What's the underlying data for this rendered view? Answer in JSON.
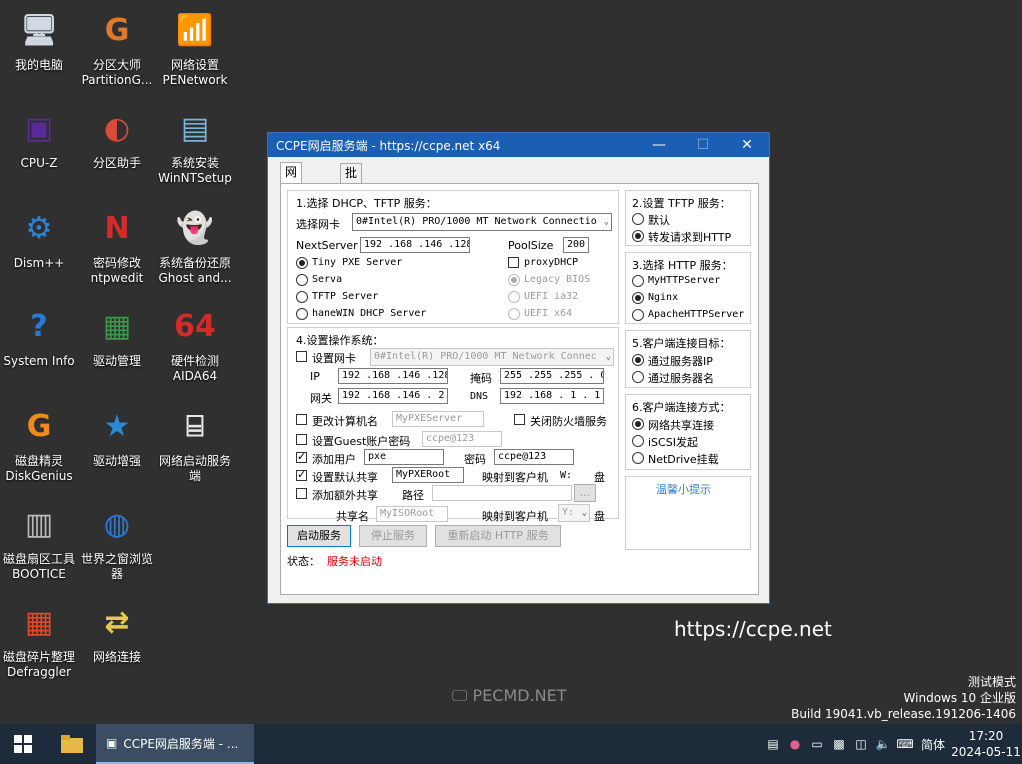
{
  "desktop": {
    "icons": [
      {
        "label": "我的电脑"
      },
      {
        "label": "分区大师\nPartitionG..."
      },
      {
        "label": "网络设置\nPENetwork"
      },
      {
        "label": "CPU-Z"
      },
      {
        "label": "分区助手"
      },
      {
        "label": "系统安装\nWinNTSetup"
      },
      {
        "label": "Dism++"
      },
      {
        "label": "密码修改\nntpwedit"
      },
      {
        "label": "系统备份还原\nGhost and..."
      },
      {
        "label": "System Info"
      },
      {
        "label": "驱动管理"
      },
      {
        "label": "硬件检测\nAIDA64"
      },
      {
        "label": "磁盘精灵\nDiskGenius"
      },
      {
        "label": "驱动增强"
      },
      {
        "label": "网络启动服务\n端"
      },
      {
        "label": "磁盘扇区工具\nBOOTICE"
      },
      {
        "label": "世界之窗浏览\n器"
      },
      {
        "label": "磁盘碎片整理\nDefraggler"
      },
      {
        "label": "网络连接"
      }
    ],
    "watermark": "PECMD.NET",
    "url_text": "https://ccpe.net",
    "wininfo": {
      "line1": "测试模式",
      "line2": "Windows 10 企业版",
      "line3": "Build 19041.vb_release.191206-1406"
    }
  },
  "taskbar": {
    "app_label": "CCPE网启服务端 - ...",
    "ime": "简体",
    "time": "17:20",
    "date": "2024-05-11"
  },
  "window": {
    "title": "CCPE网启服务端 - https://ccpe.net x64",
    "tabs": [
      "网启设置",
      "批量网克"
    ],
    "dhcp": {
      "heading": "1.选择 DHCP、TFTP 服务：",
      "nic_label": "选择网卡",
      "nic_value": "0#Intel(R) PRO/1000 MT Network Connectio",
      "nextserver_label": "NextServer",
      "nextserver_value": "192 .168 .146 .128",
      "poolsize_label": "PoolSize",
      "poolsize_value": "200",
      "servers": [
        "Tiny PXE Server",
        "Serva",
        "TFTP Server",
        "haneWIN DHCP Server"
      ],
      "proxy_label": "proxyDHCP",
      "boot_modes": [
        "Legacy BIOS",
        "UEFI ia32",
        "UEFI x64"
      ]
    },
    "os": {
      "heading": "4.设置操作系统：",
      "set_nic_label": "设置网卡",
      "set_nic_value": "0#Intel(R) PRO/1000 MT Network Connec",
      "ip_label": "IP",
      "ip_value": "192 .168 .146 .128",
      "mask_label": "掩码",
      "mask_value": "255 .255 .255 . 0",
      "gw_label": "网关",
      "gw_value": "192 .168 .146 . 2",
      "dns_label": "DNS",
      "dns_value": "192 .168 . 1  . 1",
      "rename_label": "更改计算机名",
      "rename_value": "MyPXEServer",
      "firewall_label": "关闭防火墙服务",
      "guest_label": "设置Guest账户密码",
      "guest_value": "ccpe@123",
      "adduser_label": "添加用户",
      "adduser_value": "pxe",
      "password_label": "密码",
      "password_value": "ccpe@123",
      "share_label": "设置默认共享",
      "share_value": "MyPXERoot",
      "map_label": "映射到客户机",
      "map_drive1": "W:",
      "disk_label": "盘",
      "extra_label": "添加额外共享",
      "path_label": "路径",
      "browse_label": "...",
      "sharename_label": "共享名",
      "sharename_value": "MyISORoot",
      "map_drive2": "Y:"
    },
    "tftp": {
      "heading": "2.设置 TFTP 服务：",
      "options": [
        "默认",
        "转发请求到HTTP"
      ]
    },
    "http": {
      "heading": "3.选择 HTTP 服务：",
      "options": [
        "MyHTTPServer",
        "Nginx",
        "ApacheHTTPServer"
      ]
    },
    "target": {
      "heading": "5.客户端连接目标：",
      "options": [
        "通过服务器IP",
        "通过服务器名"
      ]
    },
    "conn": {
      "heading": "6.客户端连接方式：",
      "options": [
        "网络共享连接",
        "iSCSI发起",
        "NetDrive挂载"
      ]
    },
    "hint_label": "温馨小提示",
    "buttons": {
      "start": "启动服务",
      "stop": "停止服务",
      "restart": "重新启动 HTTP 服务"
    },
    "status_label": "状态：",
    "status_value": "服务未启动"
  },
  "colors": {
    "titlebar": "#1a5fb4",
    "status_red": "#e00000",
    "hint_blue": "#3c7fd0"
  }
}
